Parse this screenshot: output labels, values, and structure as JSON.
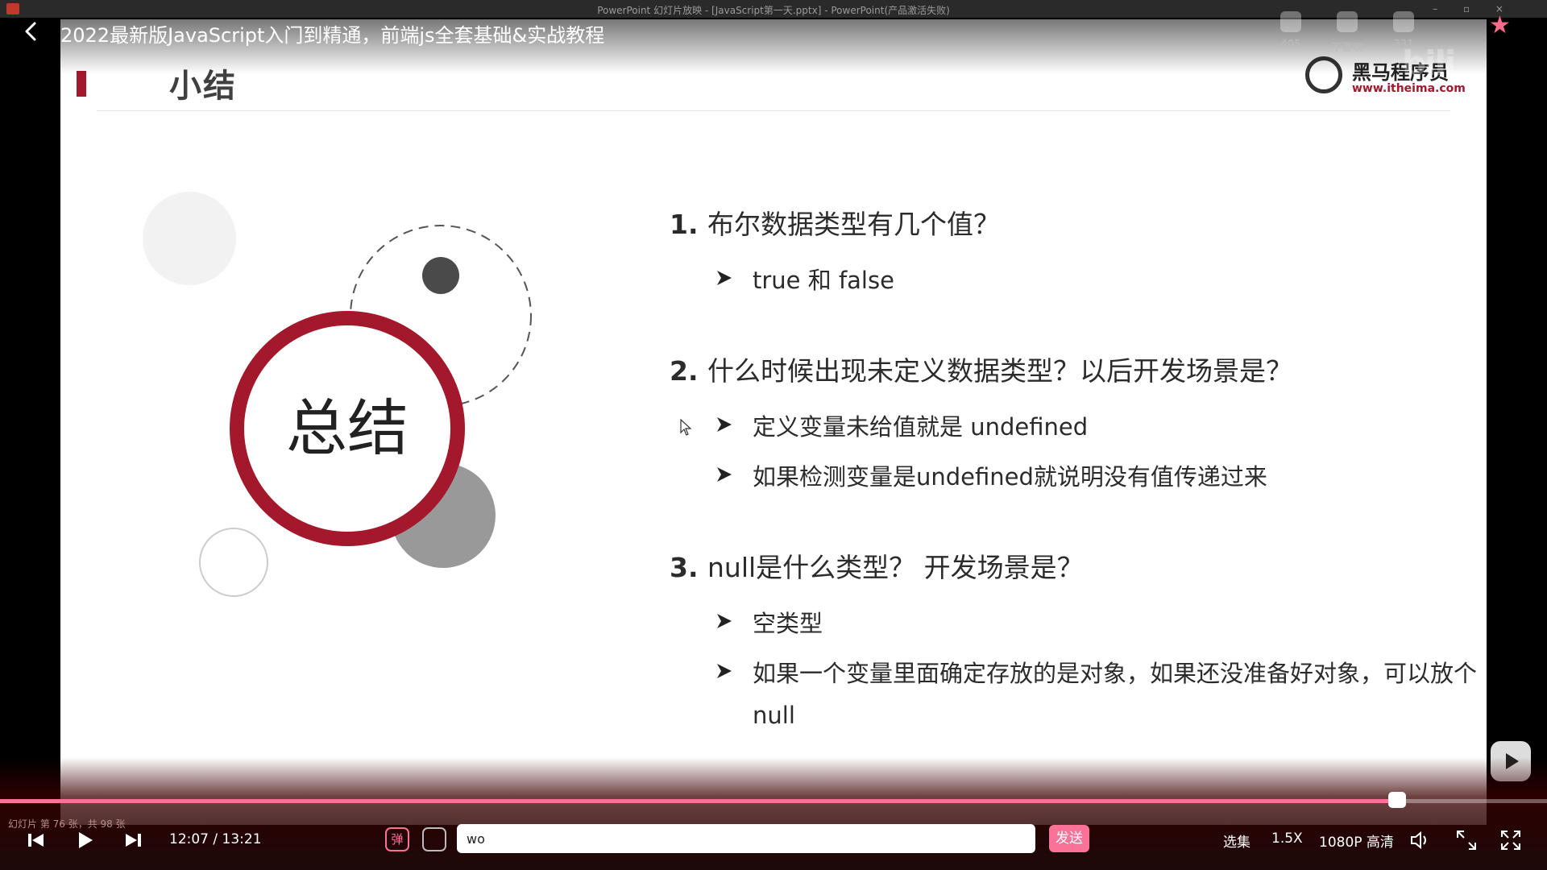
{
  "powerpoint": {
    "window_title": "PowerPoint 幻灯片放映 - [JavaScript第一天.pptx] - PowerPoint(产品激活失败)"
  },
  "video": {
    "title": "2022最新版JavaScript入门到精通，前端js全套基础&实战教程"
  },
  "stats": {
    "like_count": "405",
    "dislike_label": "不喜欢",
    "coin_count": "331"
  },
  "slide": {
    "title": "小结",
    "summary_label": "总结",
    "brand": {
      "name": "黑马程序员",
      "url": "www.itheima.com"
    },
    "questions": [
      {
        "num": "1.",
        "text": "布尔数据类型有几个值？",
        "answers": [
          "true 和 false"
        ]
      },
      {
        "num": "2.",
        "text": "什么时候出现未定义数据类型？以后开发场景是？",
        "answers": [
          "定义变量未给值就是 undefined",
          "如果检测变量是undefined就说明没有值传递过来"
        ]
      },
      {
        "num": "3.",
        "text": "null是什么类型？ 开发场景是？",
        "answers": [
          "空类型",
          "如果一个变量里面确定存放的是对象，如果还没准备好对象，可以放个null"
        ]
      }
    ]
  },
  "player": {
    "slide_count": "幻灯片 第 76 张，共 98 张",
    "current_time": "12:07",
    "total_time": "13:21",
    "time_display": "12:07 / 13:21",
    "progress": 0.903,
    "danmaku_toggle": "弹",
    "danmaku_input_value": "wo",
    "send_label": "发送",
    "episodes_label": "选集",
    "speed_label": "1.5X",
    "quality_label": "1080P 高清"
  },
  "colors": {
    "accent": "#fb7299",
    "slide_red": "#a3182a"
  },
  "icons": [
    "back-arrow-icon",
    "like-icon",
    "dislike-icon",
    "coin-icon",
    "favorite-star-icon",
    "prev-icon",
    "play-icon",
    "next-icon",
    "danmaku-settings-icon",
    "volume-icon",
    "web-fullscreen-icon",
    "fullscreen-icon",
    "tv-play-icon",
    "mouse-cursor-icon"
  ]
}
